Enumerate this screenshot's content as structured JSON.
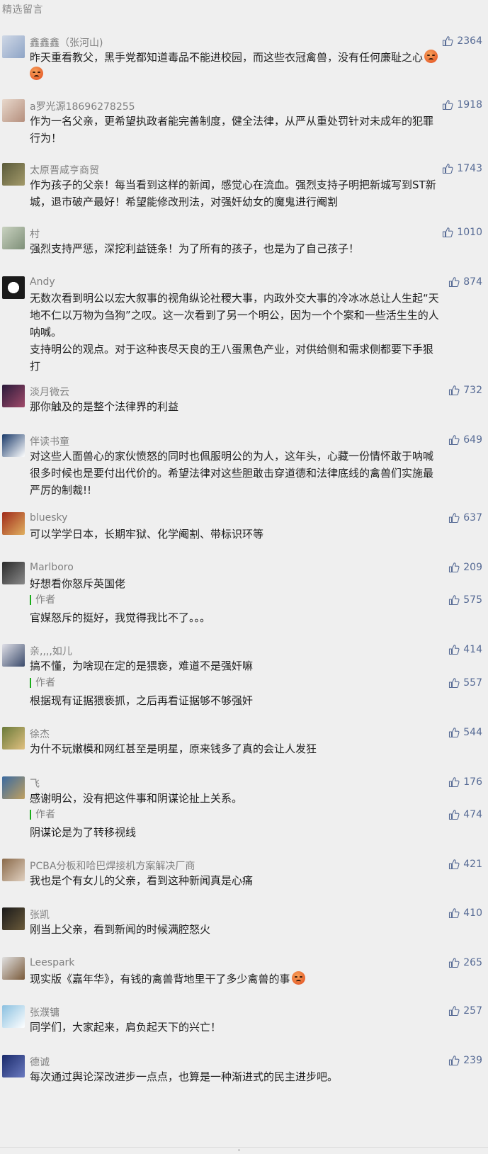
{
  "section": {
    "title": "精选留言"
  },
  "colors": {
    "link": "#576b95",
    "author_bar": "#1aad19",
    "name": "#808080"
  },
  "comments": [
    {
      "name": "鑫鑫鑫（张河山)",
      "likes": "2364",
      "lines": [
        "昨天重看教父，黑手党都知道毒品不能进校园，而这些衣冠禽兽，没有任何廉耻之心"
      ],
      "emoji_tail": true
    },
    {
      "name": "a罗光源18696278255",
      "likes": "1918",
      "lines": [
        "作为一名父亲，更希望执政者能完善制度，健全法律，从严从重处罚针对未成年的犯罪",
        "行为！"
      ]
    },
    {
      "name": "太原晋咸亨商贸",
      "likes": "1743",
      "lines": [
        "作为孩子的父亲！每当看到这样的新闻，感觉心在流血。强烈支持子明把新城写到ST新",
        "城，退市破产最好！希望能修改刑法，对强奸幼女的魔鬼进行阉割"
      ]
    },
    {
      "name": "村",
      "likes": "1010",
      "lines": [
        "强烈支持严惩，深挖利益链条！为了所有的孩子，也是为了自己孩子！"
      ]
    },
    {
      "name": "Andy",
      "likes": "874",
      "lines": [
        "无数次看到明公以宏大叙事的视角纵论社稷大事，内政外交大事的冷冰冰总让人生起“天",
        "地不仁以万物为刍狗”之叹。这一次看到了另一个明公，因为一个个案和一些活生生的人",
        "呐喊。",
        "支持明公的观点。对于这种丧尽天良的王八蛋黑色产业，对供给侧和需求侧都要下手狠",
        "打"
      ]
    },
    {
      "name": "淡月微云",
      "likes": "732",
      "lines": [
        "那你触及的是整个法律界的利益"
      ]
    },
    {
      "name": "伴读书童",
      "likes": "649",
      "lines": [
        "对这些人面兽心的家伙愤怒的同时也佩服明公的为人，这年头，心藏一份情怀敢于呐喊",
        "很多时候也是要付出代价的。希望法律对这些胆敢击穿道德和法律底线的禽兽们实施最",
        "严厉的制裁!!"
      ]
    },
    {
      "name": "bluesky",
      "likes": "637",
      "lines": [
        "可以学学日本，长期牢狱、化学阉割、带标识环等"
      ]
    },
    {
      "name": "Marlboro",
      "likes": "209",
      "lines": [
        "好想看你怒斥英国佬"
      ],
      "reply": {
        "author": "作者",
        "likes": "575",
        "text": "官媒怒斥的挺好，我觉得我比不了。。。"
      }
    },
    {
      "name": "亲,,,,如儿",
      "likes": "414",
      "lines": [
        "搞不懂，为啥现在定的是猥亵，难道不是强奸嘛"
      ],
      "reply": {
        "author": "作者",
        "likes": "557",
        "text": "根据现有证据猥亵抓，之后再看证据够不够强奸"
      }
    },
    {
      "name": "徐杰",
      "likes": "544",
      "lines": [
        "为什不玩嫩模和网红甚至是明星，原来钱多了真的会让人发狂"
      ]
    },
    {
      "name": "飞",
      "likes": "176",
      "lines": [
        "感谢明公，没有把这件事和阴谋论扯上关系。"
      ],
      "reply": {
        "author": "作者",
        "likes": "474",
        "text": "阴谋论是为了转移视线"
      }
    },
    {
      "name": "PCBA分板和哈巴焊接机方案解决厂商",
      "likes": "421",
      "lines": [
        "我也是个有女儿的父亲，看到这种新闻真是心痛"
      ]
    },
    {
      "name": "张凯",
      "likes": "410",
      "lines": [
        "刚当上父亲，看到新闻的时候满腔怒火"
      ]
    },
    {
      "name": "Leespark",
      "likes": "265",
      "lines": [
        "现实版《嘉年华》，有钱的禽兽背地里干了多少禽兽的事"
      ],
      "emoji_inline": true
    },
    {
      "name": "张濮镛",
      "likes": "257",
      "lines": [
        "同学们，大家起来，肩负起天下的兴亡！"
      ]
    },
    {
      "name": "德诚",
      "likes": "239",
      "lines": [
        "每次通过舆论深改进步一点点，也算是一种渐进式的民主进步吧。"
      ]
    }
  ]
}
